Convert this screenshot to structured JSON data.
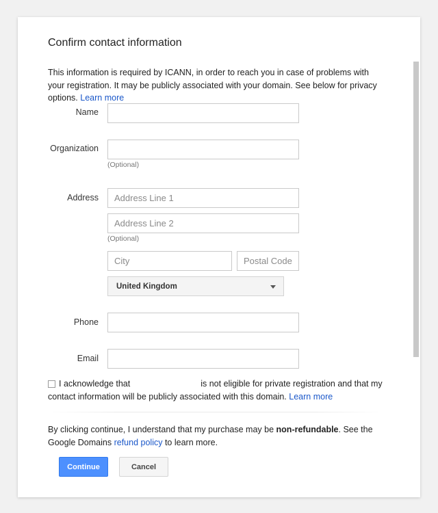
{
  "dialog": {
    "title": "Confirm contact information",
    "intro_text": "This information is required by ICANN, in order to reach you in case of problems with your registration. It may be publicly associated with your domain. See below for privacy options.",
    "intro_link": "Learn more"
  },
  "form": {
    "name": {
      "label": "Name",
      "value": ""
    },
    "organization": {
      "label": "Organization",
      "value": "",
      "hint": "(Optional)"
    },
    "address": {
      "label": "Address",
      "line1_placeholder": "Address Line 1",
      "line2_placeholder": "Address Line 2",
      "line2_hint": "(Optional)",
      "city_placeholder": "City",
      "postal_placeholder": "Postal Code",
      "country_selected": "United Kingdom"
    },
    "phone": {
      "label": "Phone",
      "value": ""
    },
    "email": {
      "label": "Email",
      "value": ""
    }
  },
  "acknowledgement": {
    "checked": false,
    "text_before": "I acknowledge that",
    "text_after": "is not eligible for private registration and that my contact information will be publicly associated with this domain.",
    "link": "Learn more"
  },
  "footer": {
    "text_before": "By clicking continue, I understand that my purchase may be",
    "bold": "non-refundable",
    "text_mid": ". See the Google Domains",
    "link": "refund policy",
    "text_after": "to learn more."
  },
  "buttons": {
    "continue_label": "Continue",
    "cancel_label": "Cancel"
  },
  "colors": {
    "primary_button": "#4d90fe",
    "link": "#1a57c9"
  }
}
